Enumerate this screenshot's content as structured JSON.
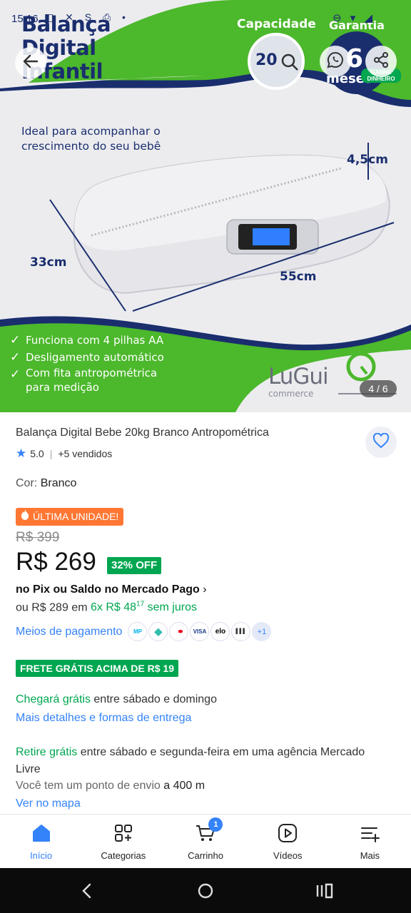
{
  "status_bar": {
    "time": "15:16",
    "left_icons": "◧ ✕ S ⎙ •",
    "right_icons": "⊖ ▾ ◢"
  },
  "gallery": {
    "promo_title": [
      "Balança",
      "Digital",
      "Infantil"
    ],
    "capacity_label": "Capacidade",
    "capacity_value": "20",
    "warranty_label": "Garantia",
    "warranty_value": "6",
    "warranty_unit": "meses",
    "ganhe_label": "GANHE DINHEIRO",
    "subtitle": "Ideal para acompanhar o crescimento do seu bebê",
    "dim_height": "4,5cm",
    "dim_depth": "33cm",
    "dim_width": "55cm",
    "features": [
      "Funciona com 4 pilhas AA",
      "Desligamento automático",
      "Com fita antropométrica para medição"
    ],
    "brand": "LuGui",
    "brand_sub": "commerce",
    "counter": "4 / 6"
  },
  "product": {
    "title": "Balança Digital Bebe 20kg Branco Antropométrica",
    "rating": "5.0",
    "sold": "+5 vendidos",
    "color_label": "Cor:",
    "color_value": "Branco",
    "last_unit_badge": "ÚLTIMA UNIDADE!",
    "old_price": "R$ 399",
    "price": "R$ 269",
    "discount": "32% OFF",
    "pix_text": "no Pix ou Saldo no Mercado Pago",
    "installments_prefix": "ou R$ 289",
    "installments_mid": "em",
    "installments_value": "6x R$ 48",
    "installments_cents": "17",
    "installments_suffix": "sem juros",
    "payment_link": "Meios de pagamento",
    "payment_more": "+1",
    "payment_icons": [
      "mp-icon",
      "pix-icon",
      "mastercard-icon",
      "visa-icon",
      "elo-icon",
      "boleto-icon"
    ],
    "payment_icon_labels": [
      "MP",
      "◆",
      "●●",
      "VISA",
      "elo",
      "▌▌▌"
    ],
    "free_ship_badge": "FRETE GRÁTIS ACIMA DE R$ 19",
    "arrival_green": "Chegará grátis",
    "arrival_rest": "entre sábado e domingo",
    "details_link": "Mais detalhes e formas de entrega",
    "retire_green": "Retire grátis",
    "retire_rest": "entre sábado e segunda-feira em uma agência Mercado Livre",
    "ponto_text": "Você tem um ponto de envio",
    "ponto_dist": "a 400 m",
    "map_link": "Ver no mapa"
  },
  "bottom_nav": {
    "items": [
      {
        "label": "Início",
        "icon": "home-icon"
      },
      {
        "label": "Categorias",
        "icon": "categories-icon"
      },
      {
        "label": "Carrinho",
        "icon": "cart-icon",
        "badge": "1"
      },
      {
        "label": "Vídeos",
        "icon": "video-icon"
      },
      {
        "label": "Mais",
        "icon": "menu-plus-icon"
      }
    ]
  },
  "colors": {
    "accent": "#3483fa",
    "green": "#00a650",
    "orange": "#ff7733",
    "promo_navy": "#1a2e6e",
    "promo_green": "#4cb82c"
  }
}
